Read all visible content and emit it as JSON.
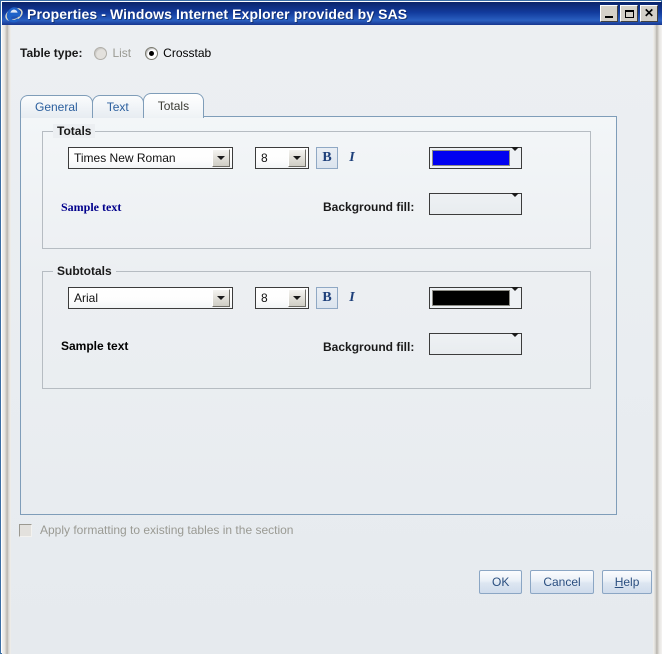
{
  "window": {
    "title": "Properties - Windows Internet Explorer provided by SAS",
    "icon": "internet-explorer-icon",
    "controls": {
      "minimize": "_",
      "maximize": "□",
      "close": "✕"
    }
  },
  "table_type": {
    "label": "Table type:",
    "options": [
      {
        "label": "List",
        "selected": false,
        "disabled": true
      },
      {
        "label": "Crosstab",
        "selected": true,
        "disabled": false
      }
    ]
  },
  "tabs": [
    {
      "label": "General",
      "active": false
    },
    {
      "label": "Text",
      "active": false
    },
    {
      "label": "Totals",
      "active": true
    }
  ],
  "groups": [
    {
      "legend": "Totals",
      "font": "Times New Roman",
      "font_size": "8",
      "bold_label": "B",
      "bold_pressed": true,
      "italic_label": "I",
      "italic_pressed": false,
      "font_color": "#0000f0",
      "background_fill_label": "Background fill:",
      "background_fill_value": "",
      "sample_text": "Sample text",
      "sample_color": "#00008b"
    },
    {
      "legend": "Subtotals",
      "font": "Arial",
      "font_size": "8",
      "bold_label": "B",
      "bold_pressed": true,
      "italic_label": "I",
      "italic_pressed": false,
      "font_color": "#000000",
      "background_fill_label": "Background fill:",
      "background_fill_value": "",
      "sample_text": "Sample text",
      "sample_color": "#000000"
    }
  ],
  "apply_checkbox": {
    "label": "Apply formatting to existing tables in the section",
    "checked": false,
    "disabled": true
  },
  "buttons": {
    "ok": "OK",
    "cancel": "Cancel",
    "help_prefix": "H",
    "help_suffix": "elp"
  },
  "colors": {
    "titlebar_start": "#0a246a",
    "titlebar_end": "#2a5fc0",
    "panel_border": "#7f9db9",
    "tab_text": "#2b5f9e",
    "body_bg": "#eceff2"
  }
}
